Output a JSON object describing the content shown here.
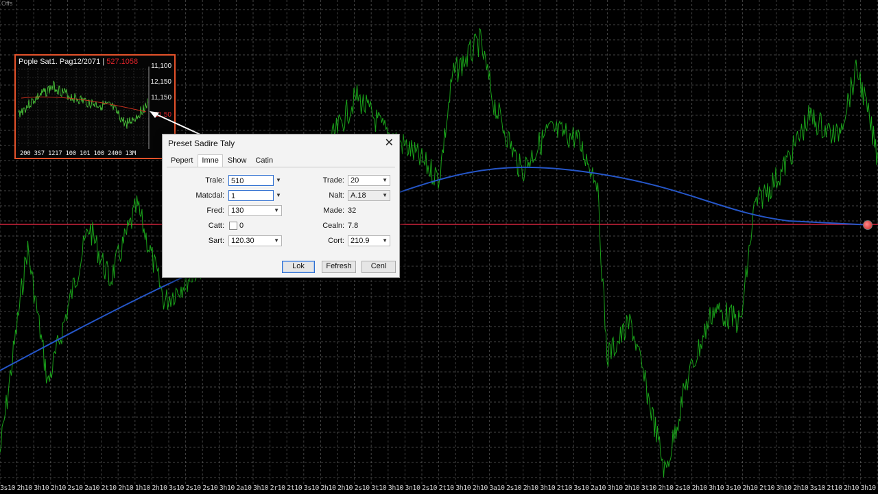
{
  "window": {
    "corner_label": "Offs"
  },
  "chart": {
    "x_axis_ticks": [
      "3s10",
      "2h10",
      "3h10",
      "2h10",
      "2s10",
      "2a10",
      "2t10",
      "2h10",
      "1h10",
      "2h10",
      "3s10",
      "2s10",
      "2s10",
      "3h10",
      "2a10",
      "3h10",
      "2r10",
      "2t10",
      "3s10",
      "2h10",
      "2h10",
      "2s10",
      "3t10",
      "3h10",
      "3n10",
      "2s10",
      "2t10",
      "3h10",
      "2h10",
      "3a10",
      "2s10",
      "2h10",
      "3h10",
      "2t10",
      "3s10",
      "2a10",
      "3h10",
      "2h10",
      "3t10",
      "2h10",
      "2s10",
      "2h10",
      "3h10",
      "3s10",
      "2h10",
      "2t10",
      "3h10",
      "2h10",
      "3s10",
      "2t10",
      "2h10",
      "3h10",
      "2r10"
    ],
    "colors": {
      "price": "#1fbf1f",
      "moving_average": "#2556c8",
      "level_line": "#d0243c",
      "grid": "#7a7a7a"
    }
  },
  "inset": {
    "title": "Pople Sat1. Pag12/2071",
    "title_red": "527.1058",
    "y_labels": [
      "11,100",
      "12,150",
      "11,150",
      "11,50"
    ],
    "x_labels": "200 3S7  1217 100  101  100 2400  13M"
  },
  "dialog": {
    "title": "Preset Sadire Taly",
    "tabs": [
      "Pepert",
      "Imne",
      "Show",
      "Catin"
    ],
    "active_tab": 1,
    "left_fields": {
      "trale": {
        "label": "Trale:",
        "value": "510"
      },
      "material": {
        "label": "Matcdal:",
        "value": "1"
      },
      "fred": {
        "label": "Fred:",
        "value": "130"
      },
      "catt": {
        "label": "Catt:",
        "value": "0"
      },
      "sart": {
        "label": "Sart:",
        "value": "120.30"
      }
    },
    "right_fields": {
      "trade": {
        "label": "Trade:",
        "value": "20"
      },
      "nalt": {
        "label": "Nalt:",
        "value": "A.18"
      },
      "made": {
        "label": "Made:",
        "value": "32"
      },
      "cealn": {
        "label": "Cealn:",
        "value": "7.8"
      },
      "cort": {
        "label": "Cort:",
        "value": "210.9"
      }
    },
    "buttons": {
      "ok": "Lok",
      "refresh": "Fefresh",
      "cancel": "Cenl"
    }
  }
}
